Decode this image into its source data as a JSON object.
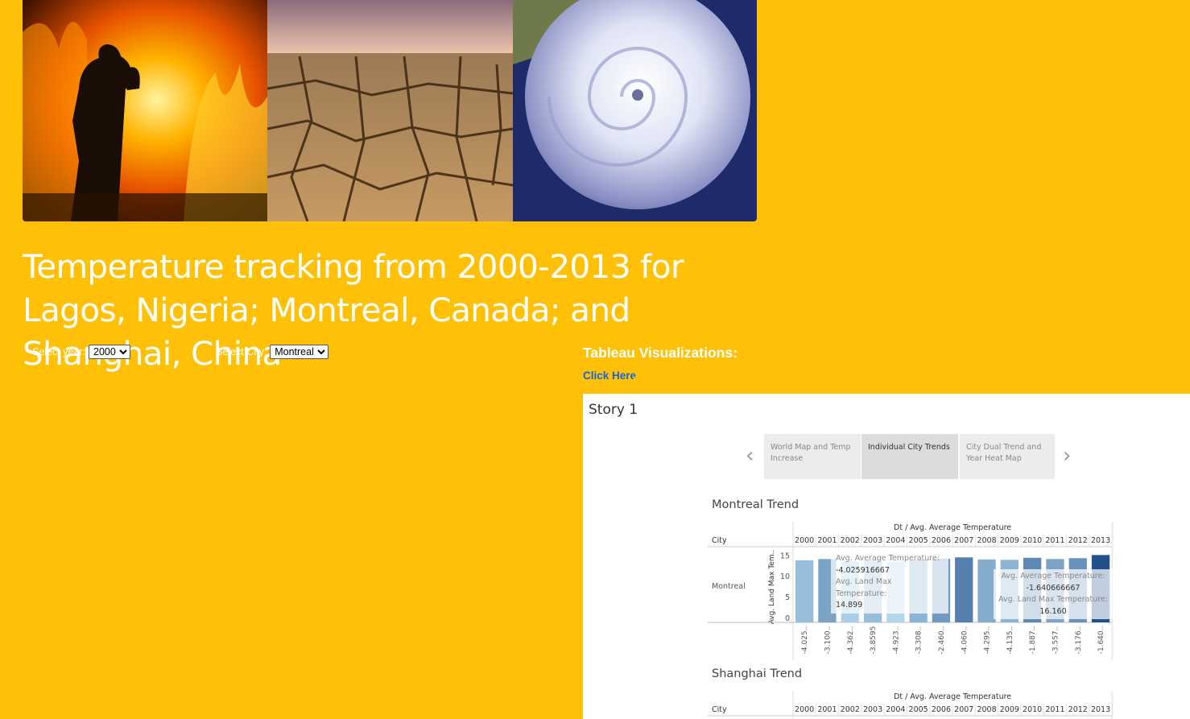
{
  "banner": {
    "panels": [
      "wildfire-image",
      "drought-cracked-earth-image",
      "hurricane-satellite-image"
    ]
  },
  "page": {
    "title": "Temperature tracking from 2000-2013 for Lagos, Nigeria; Montreal, Canada; and Shanghai, China"
  },
  "controls": {
    "year_label": "Select year:",
    "year_value": "2000",
    "city_label": "Select City:",
    "city_value": "Montreal"
  },
  "tableau": {
    "heading": "Tableau Visualizations:",
    "link_text": "Click Here",
    "link_suffix": "."
  },
  "story": {
    "title": "Story 1",
    "tabs": [
      {
        "label": "World Map and Temp Increase"
      },
      {
        "label": "Individual City Trends"
      },
      {
        "label": "City Dual Trend and Year Heat Map"
      }
    ],
    "prev_glyph": "‹",
    "next_glyph": "›"
  },
  "colors": {
    "page_bg": "#ffc107",
    "link": "#1565e0"
  },
  "chart_data": [
    {
      "type": "bar",
      "sheet_title": "Montreal Trend",
      "column_header": "Dt / Avg. Average Temperature",
      "row_header": "City",
      "row_label": "Montreal",
      "ylabel": "Avg. Land Max Tem..",
      "yticks": [
        "15",
        "10",
        "5",
        "0"
      ],
      "ylim": [
        0,
        17
      ],
      "categories": [
        "2000",
        "2001",
        "2002",
        "2003",
        "2004",
        "2005",
        "2006",
        "2007",
        "2008",
        "2009",
        "2010",
        "2011",
        "2012",
        "2013"
      ],
      "avg_temp_labels": [
        "-4.025..",
        "-3.100..",
        "-4.362..",
        "-3.8595",
        "-4.923..",
        "-3.308..",
        "-2.460..",
        "-4.060..",
        "-4.295..",
        "-4.135..",
        "-1.887..",
        "-3.557..",
        "-3.176..",
        "-1.640.."
      ],
      "values": [
        14.899,
        15.2,
        14.7,
        14.9,
        14.6,
        15.0,
        15.3,
        15.6,
        15.1,
        15.0,
        15.5,
        15.2,
        15.4,
        16.16
      ],
      "tooltips": [
        {
          "l1": "Avg. Average Temperature:",
          "v1": "-4.025916667",
          "l2": "Avg. Land Max Temperature:",
          "v2": "14.899"
        },
        {
          "l1": "Avg. Average Temperature:",
          "v1": "-1.640666667",
          "l2": "Avg. Land Max Temperature:",
          "v2": "16.160"
        }
      ]
    },
    {
      "type": "bar",
      "sheet_title": "Shanghai Trend",
      "column_header": "Dt / Avg. Average Temperature",
      "row_header": "City",
      "categories": [
        "2000",
        "2001",
        "2002",
        "2003",
        "2004",
        "2005",
        "2006",
        "2007",
        "2008",
        "2009",
        "2010",
        "2011",
        "2012",
        "2013"
      ]
    }
  ]
}
